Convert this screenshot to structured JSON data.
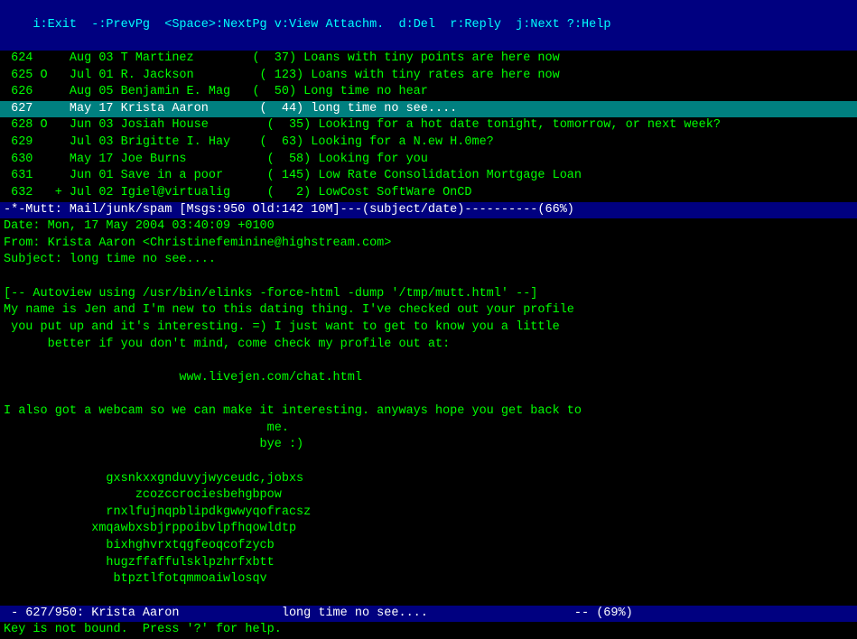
{
  "topbar": {
    "content": "i:Exit  -:PrevPg  <Space>:NextPg v:View Attachm.  d:Del  r:Reply  j:Next ?:Help"
  },
  "emailList": [
    {
      "id": "624",
      "marker": " ",
      "date": "Aug 03",
      "sender": "T Martinez",
      "count": "  37",
      "subject": "Loans with tiny points are here now",
      "highlighted": false
    },
    {
      "id": "625",
      "marker": "O",
      "date": "Jul 01",
      "sender": "R. Jackson",
      "count": " 123",
      "subject": "Loans with tiny rates are here now",
      "highlighted": false
    },
    {
      "id": "626",
      "marker": " ",
      "date": "Aug 05",
      "sender": "Benjamin E. Mag",
      "count": "  50",
      "subject": "Long time no hear",
      "highlighted": false
    },
    {
      "id": "627",
      "marker": " ",
      "date": "May 17",
      "sender": "Krista Aaron",
      "count": "  44",
      "subject": "long time no see....",
      "highlighted": true
    },
    {
      "id": "628",
      "marker": "O",
      "date": "Jun 03",
      "sender": "Josiah House",
      "count": "  35",
      "subject": "Looking for a hot date tonight, tomorrow, or next week?",
      "highlighted": false
    },
    {
      "id": "629",
      "marker": " ",
      "date": "Jul 03",
      "sender": "Brigitte I. Hay",
      "count": "  63",
      "subject": "Looking for a N.ew H.0me?",
      "highlighted": false
    },
    {
      "id": "630",
      "marker": " ",
      "date": "May 17",
      "sender": "Joe Burns",
      "count": "  58",
      "subject": "Looking for you",
      "highlighted": false
    },
    {
      "id": "631",
      "marker": " ",
      "date": "Jun 01",
      "sender": "Save in a poor",
      "count": " 145",
      "subject": "Low Rate Consolidation Mortgage Loan",
      "highlighted": false
    },
    {
      "id": "632",
      "marker": "+",
      "date": "Jul 02",
      "sender": "Igiel@virtualig",
      "count": "   2",
      "subject": "LowCost SoftWare OnCD",
      "highlighted": false
    }
  ],
  "statusBar": {
    "content": "-*-Mutt: Mail/junk/spam [Msgs:950 Old:142 10M]---(subject/date)----------(66%)"
  },
  "emailHeaders": {
    "date": "Date: Mon, 17 May 2004 03:40:09 +0100",
    "from": "From: Krista Aaron <Christinefeminine@highstream.com>",
    "subject": "Subject: long time no see...."
  },
  "autoviewLine": "[-- Autoview using /usr/bin/elinks -force-html -dump '/tmp/mutt.html' --]",
  "emailBody": {
    "paragraphs": [
      "My name is Jen and I'm new to this dating thing. I've checked out your profile",
      " you put up and it's interesting. =) I just want to get to know you a little",
      "      better if you don't mind, come check my profile out at:",
      "",
      "                        www.livejen.com/chat.html",
      "",
      "I also got a webcam so we can make it interesting. anyways hope you get back to",
      "                                    me.",
      "                                   bye :)",
      "",
      "              gxsnkxxgnduvyjwyceudc,jobxs",
      "                  zcozccrociesbehgbpow",
      "              rnxlfujnqpblipdkgwwyqofracsz",
      "            xmqawbxsbjrppoibvlpfhqowldtp",
      "              bixhghvrxtqgfeoqcofzycb",
      "              hugzffaffulsklpzhrfxbtt",
      "               btpztlfotqmmoaiwlosqv"
    ]
  },
  "bottomStatus": {
    "content": " - 627/950: Krista Aaron              long time no see....                    -- (69%)"
  },
  "bottomHelp": {
    "content": "Key is not bound.  Press '?' for help."
  }
}
